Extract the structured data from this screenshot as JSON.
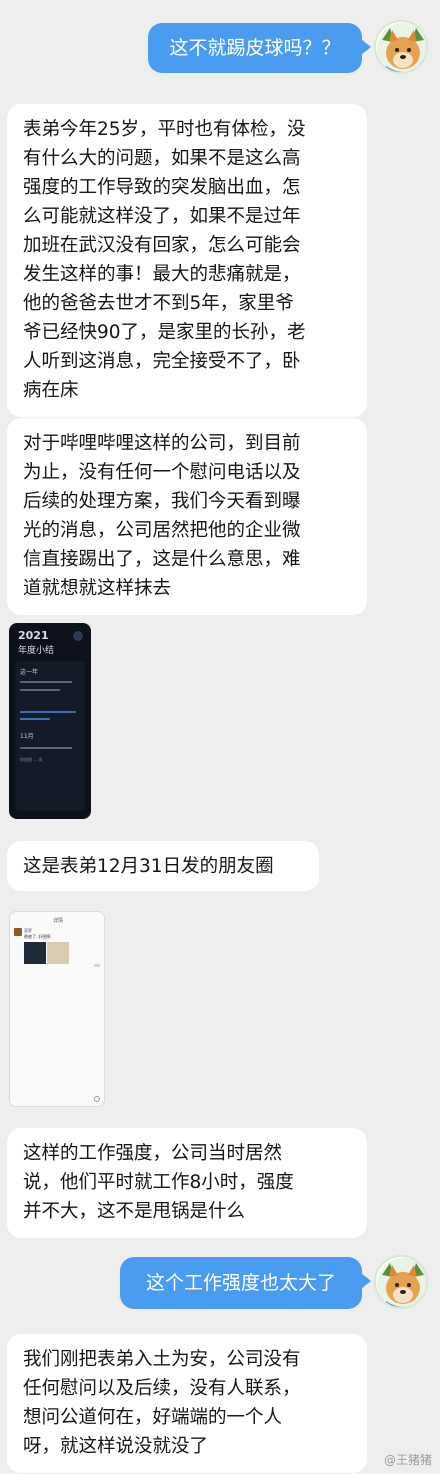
{
  "messages": {
    "m1": "这不就踢皮球吗？？",
    "m2": "表弟今年25岁，平时也有体检，没\n有什么大的问题，如果不是这么高\n强度的工作导致的突发脑出血，怎\n么可能就这样没了，如果不是过年\n加班在武汉没有回家，怎么可能会\n发生这样的事！最大的悲痛就是，\n他的爸爸去世才不到5年，家里爷\n爷已经快90了，是家里的长孙，老\n人听到这消息，完全接受不了，卧\n病在床",
    "m3": "对于哔哩哔哩这样的公司，到目前\n为止，没有任何一个慰问电话以及\n后续的处理方案，我们今天看到曝\n光的消息，公司居然把他的企业微\n信直接踢出了，这是什么意思，难\n道就想就这样抹去",
    "m4": "这是表弟12月31日发的朋友圈",
    "m5": "这样的工作强度，公司当时居然\n说，他们平时就工作8小时，强度\n并不大，这不是甩锅是什么",
    "m6": "这个工作强度也太大了",
    "m7": "我们刚把表弟入土为安，公司没有\n任何慰问以及后续，没有人联系，\n想问公道何在，好端端的一个人\n呀，就这样说没就没了"
  },
  "thumb1": {
    "year": "2021",
    "title": "年度小结",
    "line1": "这一年",
    "line2": "11月",
    "tiny": "你加班 ... 次"
  },
  "thumb2": {
    "header": "详情",
    "name": "菠萝",
    "text": "熬夜了, 好困啊"
  },
  "watermark": "@王猪猪",
  "colors": {
    "accent": "#4a9cf1",
    "background": "#eeeeee"
  }
}
